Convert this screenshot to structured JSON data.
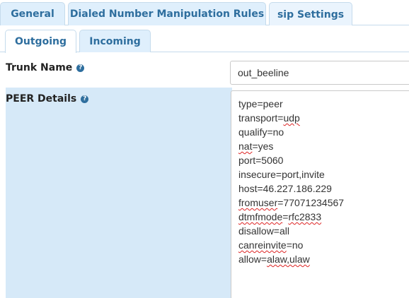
{
  "top_tabs": [
    {
      "label": "General"
    },
    {
      "label": "Dialed Number Manipulation Rules"
    },
    {
      "label": "sip Settings"
    }
  ],
  "sub_tabs": [
    {
      "label": "Outgoing"
    },
    {
      "label": "Incoming"
    }
  ],
  "form": {
    "trunk_name_label": "Trunk Name",
    "trunk_name_value": "out_beeline",
    "peer_details_label": "PEER Details",
    "help_icon_glyph": "?",
    "peer_lines": {
      "l0a": "type=peer",
      "l1a": "transport=",
      "l1b": "udp",
      "l2a": "qualify=no",
      "l3b": "nat",
      "l3c": "=yes",
      "l4a": "port=5060",
      "l5a": "insecure=port,invite",
      "l6a": "host=46.227.186.229",
      "l7b": "fromuser",
      "l7c": "=77071234567",
      "l8b": "dtmfmode",
      "l8c": "=",
      "l8d": "rfc2833",
      "l9a": "disallow=all",
      "l10b": "canreinvite",
      "l10c": "=no",
      "l11a": "allow=",
      "l11b": "alaw,ulaw"
    }
  },
  "colors": {
    "tab_text": "#2e6e9e",
    "tab_bg": "#dfeffc",
    "tab_border": "#c5dbec",
    "peer_label_bg": "#d6e9f8"
  }
}
